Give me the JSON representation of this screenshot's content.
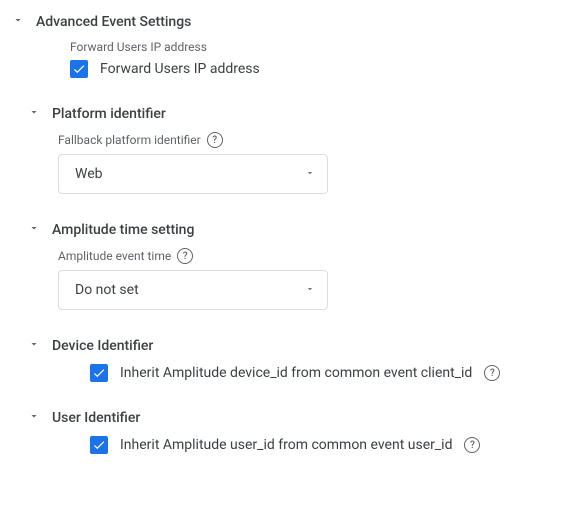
{
  "advanced": {
    "title": "Advanced Event Settings",
    "forward_ip": {
      "label": "Forward Users IP address",
      "checkbox_label": "Forward Users IP address"
    },
    "platform": {
      "title": "Platform identifier",
      "field_label": "Fallback platform identifier",
      "value": "Web"
    },
    "time": {
      "title": "Amplitude time setting",
      "field_label": "Amplitude event time",
      "value": "Do not set"
    },
    "device": {
      "title": "Device Identifier",
      "checkbox_label": "Inherit Amplitude device_id from common event client_id"
    },
    "user": {
      "title": "User Identifier",
      "checkbox_label": "Inherit Amplitude user_id from common event user_id"
    }
  }
}
